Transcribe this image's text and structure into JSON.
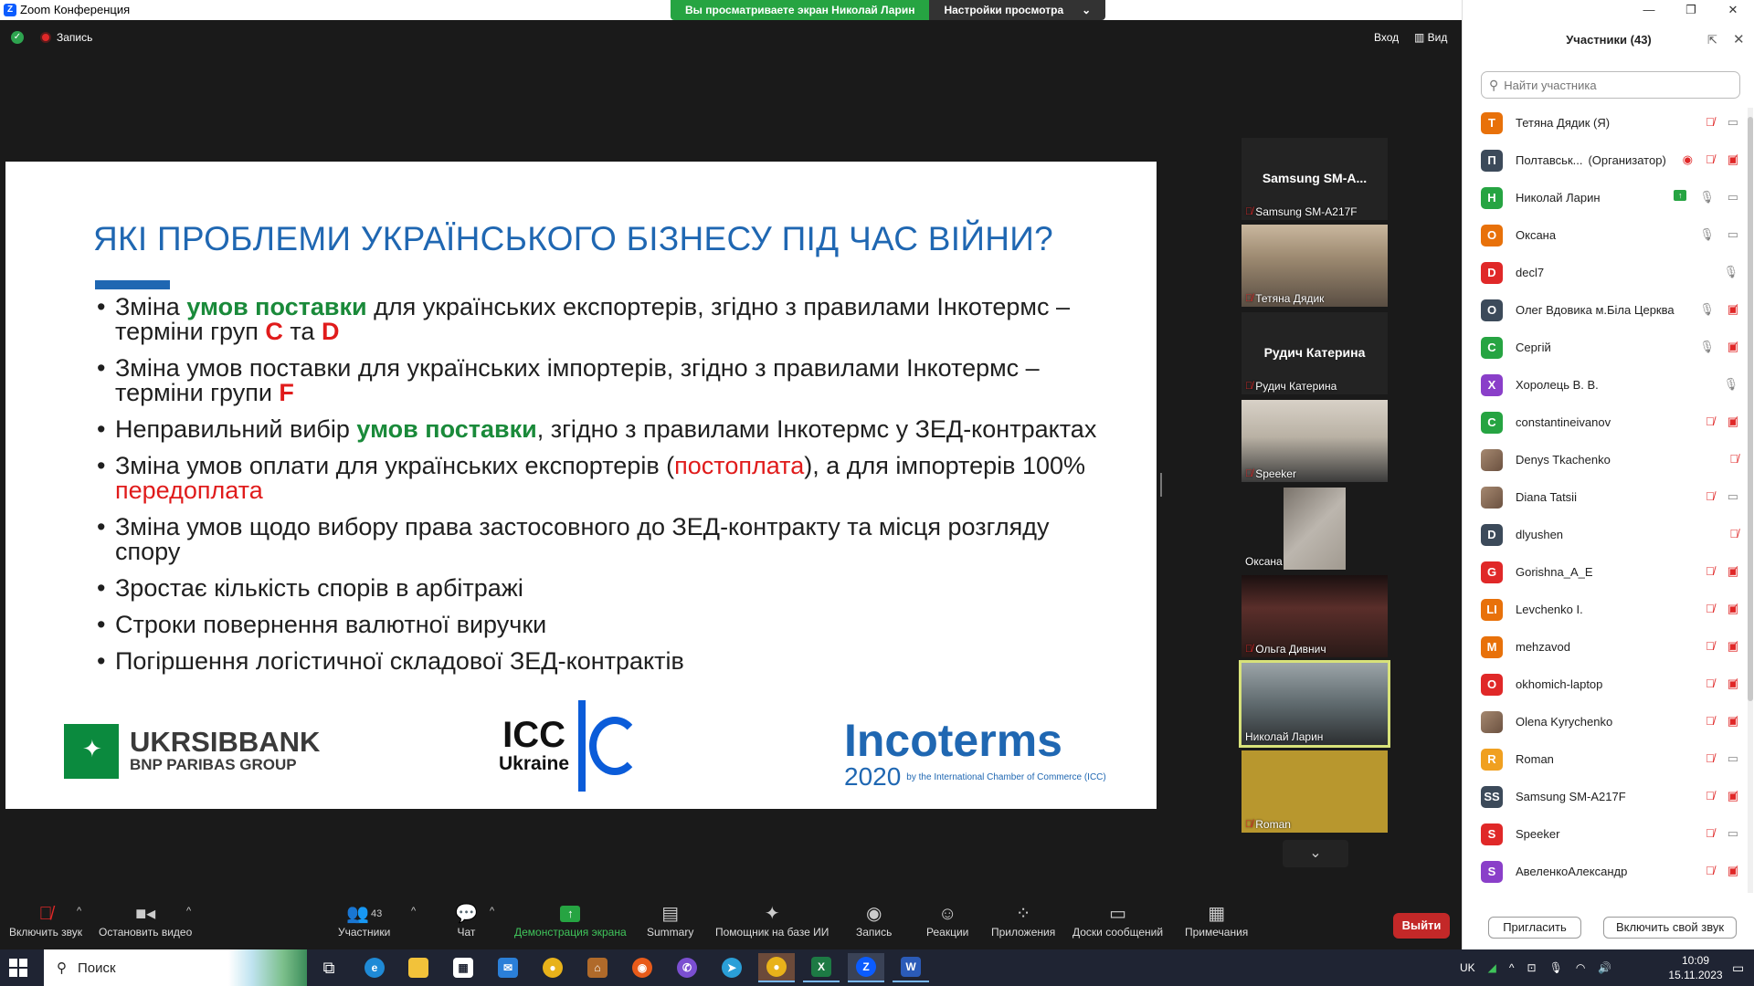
{
  "window": {
    "title": "Zoom Конференция",
    "banner_viewing": "Вы просматриваете экран Николай Ларин",
    "banner_options": "Настройки просмотра",
    "recording_label": "Запись",
    "enter_label": "Вход",
    "view_label": "Вид",
    "controls": [
      "—",
      "❐",
      "✕"
    ]
  },
  "slide": {
    "title": "ЯКІ ПРОБЛЕМИ УКРАЇНСЬКОГО БІЗНЕСУ ПІД ЧАС ВІЙНИ?",
    "bullets": {
      "b1_a": "Зміна ",
      "b1_hl": "умов поставки",
      "b1_b": " для українських експортерів, згідно з правилами Інкотермс – терміни груп ",
      "b1_c": "С",
      "b1_d": " та ",
      "b1_e": "D",
      "b2_a": "Зміна умов поставки для українських імпортерів, згідно з правилами Інкотермс – терміни групи ",
      "b2_f": "F",
      "b3_a": "Неправильний вибір ",
      "b3_hl": "умов поставки",
      "b3_b": ", згідно з правилами Інкотермс у ЗЕД-контрактах",
      "b4_a": "Зміна умов оплати для українських експортерів (",
      "b4_hl": "постоплата",
      "b4_b": "), а для імпортерів 100% ",
      "b4_hl2": "передоплата",
      "b5": "Зміна умов щодо вибору права застосовного до ЗЕД-контракту та місця розгляду спору",
      "b6": "Зростає кількість спорів в арбітражі",
      "b7": "Строки повернення валютної виручки",
      "b8": "Погіршення логістичної складової ЗЕД-контрактів"
    },
    "logos": {
      "ukrsib_name": "UKRSIBBANK",
      "ukrsib_sub": "BNP PARIBAS GROUP",
      "icc_top": "ICC",
      "icc_bottom": "Ukraine",
      "inco_name": "Incoterms",
      "inco_year": "2020",
      "inco_by": "by the International Chamber of Commerce (ICC)"
    }
  },
  "video_strip": {
    "samsung_center": "Samsung  SM-A...",
    "samsung_name": "Samsung SM-A217F",
    "tetyana": "Тетяна Дядик",
    "rudych_center": "Рудич Катерина",
    "rudych_name": "Рудич Катерина",
    "speaker": "Speeker",
    "oksana": "Оксана",
    "olga": "Ольга Дивнич",
    "nikolay": "Николай Ларин",
    "roman": "Roman",
    "down_arrow": "⌄"
  },
  "toolbar": {
    "mute": "Включить звук",
    "video": "Остановить видео",
    "participants": "Участники",
    "participants_count": "43",
    "chat": "Чат",
    "share": "Демонстрация экрана",
    "summary": "Summary",
    "ai": "Помощник на базе ИИ",
    "record": "Запись",
    "reactions": "Реакции",
    "apps": "Приложения",
    "boards": "Доски сообщений",
    "notes": "Примечания",
    "leave": "Выйти"
  },
  "panel": {
    "title": "Участники (43)",
    "search_placeholder": "Найти участника",
    "invite": "Пригласить",
    "unmute_self": "Включить свой звук",
    "participants": [
      {
        "initial": "Т",
        "color": "#e8710a",
        "name": "Тетяна Дядик (Я)",
        "role": "",
        "icons": [
          "mic-off",
          "vid"
        ]
      },
      {
        "initial": "П",
        "color": "#3c4a5a",
        "name": "Полтавськ...",
        "role": "(Организатор)",
        "icons": [
          "eye",
          "mic-off",
          "vid-off"
        ]
      },
      {
        "initial": "Н",
        "color": "#26a442",
        "name": "Николай Ларин",
        "role": "",
        "icons": [
          "share",
          "mic",
          "vid"
        ]
      },
      {
        "initial": "О",
        "color": "#e8710a",
        "name": "Оксана",
        "role": "",
        "icons": [
          "mic",
          "vid"
        ]
      },
      {
        "initial": "D",
        "color": "#e02828",
        "name": "decl7",
        "role": "",
        "icons": [
          "mic"
        ]
      },
      {
        "initial": "О",
        "color": "#3c4a5a",
        "name": "Олег Вдовика м.Біла Церква",
        "role": "",
        "icons": [
          "mic",
          "vid-off"
        ]
      },
      {
        "initial": "С",
        "color": "#26a442",
        "name": "Сергій",
        "role": "",
        "icons": [
          "mic",
          "vid-off"
        ]
      },
      {
        "initial": "Х",
        "color": "#8a3fc9",
        "name": "Хоролець В. В.",
        "role": "",
        "icons": [
          "mic"
        ]
      },
      {
        "initial": "C",
        "color": "#26a442",
        "name": "constantineivanov",
        "role": "",
        "icons": [
          "mic-off",
          "vid-off"
        ]
      },
      {
        "initial": "",
        "color": "photo",
        "name": "Denys Tkachenko",
        "role": "",
        "icons": [
          "mic-off"
        ]
      },
      {
        "initial": "",
        "color": "photo",
        "name": "Diana Tatsii",
        "role": "",
        "icons": [
          "mic-off",
          "vid"
        ]
      },
      {
        "initial": "D",
        "color": "#3c4a5a",
        "name": "dlyushen",
        "role": "",
        "icons": [
          "mic-off"
        ]
      },
      {
        "initial": "G",
        "color": "#e02828",
        "name": "Gorishna_A_E",
        "role": "",
        "icons": [
          "mic-off",
          "vid-off"
        ]
      },
      {
        "initial": "LI",
        "color": "#e8710a",
        "name": "Levchenko I.",
        "role": "",
        "icons": [
          "mic-off",
          "vid-off"
        ]
      },
      {
        "initial": "M",
        "color": "#e8710a",
        "name": "mehzavod",
        "role": "",
        "icons": [
          "mic-off",
          "vid-off"
        ]
      },
      {
        "initial": "O",
        "color": "#e02828",
        "name": "okhomich-laptop",
        "role": "",
        "icons": [
          "mic-off",
          "vid-off"
        ]
      },
      {
        "initial": "",
        "color": "photo",
        "name": "Olena Kyrychenko",
        "role": "",
        "icons": [
          "mic-off",
          "vid-off"
        ]
      },
      {
        "initial": "R",
        "color": "#f0a020",
        "name": "Roman",
        "role": "",
        "icons": [
          "mic-off",
          "vid"
        ]
      },
      {
        "initial": "SS",
        "color": "#3c4a5a",
        "name": "Samsung SM-A217F",
        "role": "",
        "icons": [
          "mic-off",
          "vid-off"
        ]
      },
      {
        "initial": "S",
        "color": "#e02828",
        "name": "Speeker",
        "role": "",
        "icons": [
          "mic-off",
          "vid"
        ]
      },
      {
        "initial": "S",
        "color": "#8a3fc9",
        "name": "АвеленкоАлександр",
        "role": "",
        "icons": [
          "mic-off",
          "vid-off"
        ]
      }
    ]
  },
  "taskbar": {
    "search": "Поиск",
    "lang": "UK",
    "time": "10:09",
    "date": "15.11.2023"
  }
}
